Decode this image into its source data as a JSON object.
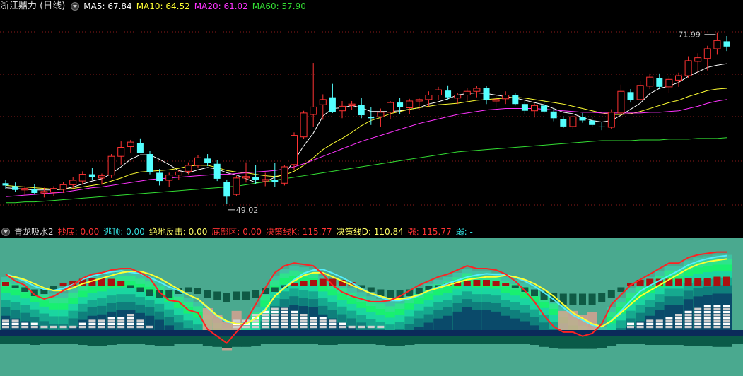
{
  "main_header": {
    "title": "浙江鼎力 (日线)",
    "ma": [
      {
        "label": "MA5: 67.84",
        "color": "#ffffff"
      },
      {
        "label": "MA10: 64.52",
        "color": "#ffff33"
      },
      {
        "label": "MA20: 61.02",
        "color": "#ff33ff"
      },
      {
        "label": "MA60: 57.90",
        "color": "#33dd33"
      }
    ]
  },
  "price_annotations": {
    "high": "71.99",
    "low": "49.02"
  },
  "indicator_header": {
    "title": "青龙吸水2",
    "items": [
      {
        "label": "抄底: 0.00",
        "color": "#ff3333"
      },
      {
        "label": "逃顶: 0.00",
        "color": "#33dddd"
      },
      {
        "label": "绝地反击: 0.00",
        "color": "#ffff66"
      },
      {
        "label": "底部区: 0.00",
        "color": "#ff3333"
      },
      {
        "label": "决策线K: 115.77",
        "color": "#ff3333"
      },
      {
        "label": "决策线D: 110.84",
        "color": "#ffff66"
      },
      {
        "label": "强: 115.77",
        "color": "#ff3333"
      },
      {
        "label": "弱: -",
        "color": "#33dddd"
      }
    ]
  },
  "colors": {
    "up": "#ff3333",
    "down": "#54ffff",
    "grid": "#8b1a1a"
  },
  "chart_data": {
    "type": "candlestick",
    "ohlc": [
      [
        51.8,
        52.3,
        51.0,
        51.5
      ],
      [
        51.4,
        51.9,
        50.6,
        50.9
      ],
      [
        50.9,
        51.4,
        50.2,
        51.1
      ],
      [
        51.0,
        51.7,
        50.3,
        50.5
      ],
      [
        50.5,
        51.2,
        49.9,
        50.7
      ],
      [
        50.6,
        51.4,
        50.1,
        51.1
      ],
      [
        51.0,
        52.0,
        50.5,
        51.6
      ],
      [
        51.6,
        52.6,
        51.1,
        52.2
      ],
      [
        52.1,
        53.4,
        51.6,
        53.0
      ],
      [
        53.0,
        53.9,
        52.3,
        52.6
      ],
      [
        52.5,
        53.1,
        51.6,
        52.8
      ],
      [
        52.9,
        55.7,
        52.5,
        55.4
      ],
      [
        55.4,
        57.4,
        54.3,
        56.6
      ],
      [
        56.7,
        57.6,
        55.9,
        57.3
      ],
      [
        57.2,
        57.8,
        55.8,
        55.8
      ],
      [
        55.7,
        56.1,
        53.0,
        53.3
      ],
      [
        53.2,
        53.7,
        51.5,
        52.1
      ],
      [
        52.2,
        53.2,
        51.3,
        52.9
      ],
      [
        52.9,
        53.5,
        52.2,
        53.3
      ],
      [
        53.4,
        54.6,
        53.0,
        54.2
      ],
      [
        54.2,
        55.6,
        53.8,
        55.2
      ],
      [
        55.1,
        55.7,
        54.1,
        54.5
      ],
      [
        54.4,
        54.9,
        52.1,
        52.4
      ],
      [
        52.0,
        52.3,
        49.0,
        50.0
      ],
      [
        50.3,
        52.8,
        50.1,
        52.5
      ],
      [
        52.5,
        54.6,
        51.9,
        52.7
      ],
      [
        52.6,
        54.2,
        51.7,
        52.2
      ],
      [
        52.1,
        53.2,
        51.4,
        52.3
      ],
      [
        52.2,
        54.5,
        51.3,
        52.0
      ],
      [
        51.8,
        54.2,
        51.5,
        54.0
      ],
      [
        54.3,
        58.6,
        53.6,
        58.2
      ],
      [
        58.0,
        61.5,
        57.7,
        61.2
      ],
      [
        61.0,
        67.9,
        59.3,
        62.0
      ],
      [
        62.3,
        63.7,
        60.3,
        63.0
      ],
      [
        63.3,
        65.1,
        61.2,
        61.3
      ],
      [
        61.5,
        62.8,
        60.5,
        62.1
      ],
      [
        62.2,
        62.8,
        61.6,
        62.4
      ],
      [
        62.3,
        63.2,
        60.5,
        60.9
      ],
      [
        60.7,
        62.0,
        59.6,
        60.5
      ],
      [
        60.7,
        61.8,
        59.3,
        61.3
      ],
      [
        61.3,
        62.8,
        60.4,
        62.6
      ],
      [
        62.6,
        63.2,
        61.0,
        62.0
      ],
      [
        61.9,
        63.1,
        61.0,
        62.8
      ],
      [
        62.8,
        63.2,
        61.6,
        63.0
      ],
      [
        63.0,
        64.1,
        62.1,
        63.6
      ],
      [
        63.6,
        64.7,
        62.9,
        64.3
      ],
      [
        64.2,
        64.9,
        63.0,
        63.3
      ],
      [
        63.2,
        63.9,
        62.4,
        63.6
      ],
      [
        63.6,
        64.5,
        62.8,
        64.1
      ],
      [
        64.1,
        64.8,
        63.3,
        64.5
      ],
      [
        64.5,
        64.8,
        62.4,
        62.9
      ],
      [
        62.8,
        63.6,
        61.9,
        63.0
      ],
      [
        63.1,
        64.1,
        62.4,
        63.6
      ],
      [
        63.6,
        63.9,
        62.2,
        62.4
      ],
      [
        62.4,
        62.8,
        61.1,
        61.5
      ],
      [
        61.5,
        62.5,
        60.6,
        62.2
      ],
      [
        62.2,
        62.9,
        61.2,
        61.4
      ],
      [
        61.4,
        61.8,
        60.1,
        60.5
      ],
      [
        60.4,
        60.8,
        59.2,
        59.4
      ],
      [
        59.4,
        60.9,
        59.0,
        60.7
      ],
      [
        60.7,
        61.2,
        59.9,
        60.2
      ],
      [
        60.2,
        60.7,
        59.3,
        59.6
      ],
      [
        59.4,
        60.0,
        58.9,
        59.3
      ],
      [
        59.3,
        61.7,
        59.1,
        61.3
      ],
      [
        61.2,
        65.0,
        60.6,
        64.1
      ],
      [
        64.0,
        64.4,
        62.6,
        62.9
      ],
      [
        63.0,
        65.5,
        62.6,
        64.9
      ],
      [
        64.8,
        66.5,
        64.4,
        66.0
      ],
      [
        65.9,
        66.5,
        64.4,
        64.7
      ],
      [
        64.7,
        66.2,
        63.9,
        65.7
      ],
      [
        65.6,
        66.6,
        64.7,
        66.2
      ],
      [
        66.2,
        68.8,
        65.9,
        68.2
      ],
      [
        68.1,
        69.2,
        66.6,
        68.6
      ],
      [
        68.5,
        70.2,
        66.9,
        69.8
      ],
      [
        69.8,
        72.0,
        69.0,
        70.9
      ],
      [
        70.8,
        71.5,
        69.5,
        70.1
      ]
    ],
    "ma": {
      "MA5": [
        51.2,
        51.1,
        51.0,
        50.9,
        50.9,
        50.9,
        51.0,
        51.3,
        51.7,
        52.1,
        52.4,
        53.1,
        54.0,
        55.0,
        55.6,
        55.6,
        55.0,
        54.3,
        53.5,
        53.2,
        53.6,
        53.9,
        53.7,
        53.2,
        52.9,
        52.4,
        51.9,
        52.0,
        52.6,
        53.0,
        54.8,
        56.8,
        58.5,
        60.8,
        61.8,
        61.9,
        62.2,
        61.9,
        61.4,
        61.4,
        61.4,
        61.5,
        61.7,
        61.9,
        62.4,
        62.7,
        63.1,
        63.6,
        63.8,
        63.9,
        63.8,
        63.6,
        63.4,
        63.2,
        62.9,
        62.6,
        62.3,
        61.8,
        61.3,
        61.1,
        60.6,
        60.2,
        60.0,
        60.2,
        60.9,
        61.7,
        62.5,
        63.8,
        64.5,
        64.8,
        65.3,
        66.1,
        66.7,
        67.3,
        67.6,
        67.8
      ],
      "MA10": [
        51.5,
        51.4,
        51.3,
        51.2,
        51.1,
        51.0,
        51.0,
        51.1,
        51.3,
        51.5,
        51.7,
        52.1,
        52.5,
        53.0,
        53.3,
        53.4,
        53.5,
        53.6,
        53.8,
        54.1,
        54.2,
        54.2,
        53.9,
        53.5,
        53.3,
        53.2,
        53.0,
        52.8,
        52.7,
        52.9,
        53.4,
        54.2,
        55.2,
        56.3,
        57.1,
        57.8,
        58.6,
        59.5,
        60.2,
        60.6,
        61.1,
        61.4,
        61.7,
        61.9,
        62.1,
        62.3,
        62.4,
        62.5,
        62.7,
        62.9,
        63.0,
        63.1,
        63.2,
        63.3,
        63.2,
        63.0,
        62.8,
        62.6,
        62.4,
        62.1,
        61.8,
        61.5,
        61.2,
        61.0,
        61.0,
        61.1,
        61.4,
        61.8,
        62.2,
        62.6,
        62.9,
        63.4,
        63.8,
        64.2,
        64.4,
        64.5
      ],
      "MA20": [
        50.0,
        50.1,
        50.2,
        50.3,
        50.4,
        50.5,
        50.6,
        50.8,
        51.0,
        51.2,
        51.3,
        51.5,
        51.7,
        51.9,
        52.1,
        52.3,
        52.4,
        52.5,
        52.6,
        52.7,
        52.8,
        52.9,
        53.0,
        53.0,
        53.1,
        53.2,
        53.3,
        53.4,
        53.5,
        53.7,
        54.0,
        54.4,
        54.9,
        55.4,
        55.9,
        56.4,
        56.9,
        57.4,
        57.8,
        58.2,
        58.6,
        59.0,
        59.4,
        59.8,
        60.1,
        60.4,
        60.7,
        61.0,
        61.2,
        61.4,
        61.6,
        61.7,
        61.8,
        61.8,
        61.8,
        61.8,
        61.7,
        61.6,
        61.5,
        61.4,
        61.3,
        61.3,
        61.2,
        61.2,
        61.2,
        61.2,
        61.2,
        61.3,
        61.3,
        61.4,
        61.5,
        61.8,
        62.1,
        62.5,
        62.8,
        63.0
      ],
      "MA60": [
        49.2,
        49.2,
        49.3,
        49.3,
        49.4,
        49.5,
        49.6,
        49.7,
        49.8,
        49.9,
        50.0,
        50.1,
        50.2,
        50.3,
        50.4,
        50.5,
        50.6,
        50.7,
        50.8,
        50.9,
        51.0,
        51.1,
        51.2,
        51.3,
        51.4,
        51.6,
        51.8,
        52.0,
        52.2,
        52.4,
        52.6,
        52.8,
        53.0,
        53.2,
        53.4,
        53.6,
        53.8,
        54.0,
        54.2,
        54.4,
        54.6,
        54.8,
        55.0,
        55.2,
        55.4,
        55.6,
        55.8,
        56.0,
        56.1,
        56.2,
        56.3,
        56.4,
        56.5,
        56.6,
        56.7,
        56.8,
        56.9,
        57.0,
        57.1,
        57.2,
        57.3,
        57.4,
        57.5,
        57.5,
        57.5,
        57.5,
        57.6,
        57.6,
        57.6,
        57.7,
        57.7,
        57.7,
        57.8,
        57.8,
        57.8,
        57.9
      ]
    },
    "indicator": {
      "K": [
        100,
        95,
        92,
        85,
        82,
        84,
        88,
        92,
        97,
        100,
        101,
        103,
        104,
        104,
        101,
        97,
        87,
        81,
        80,
        74,
        72,
        60,
        55,
        50,
        58,
        66,
        78,
        90,
        101,
        106,
        108,
        107,
        106,
        100,
        92,
        87,
        84,
        82,
        80,
        80,
        81,
        84,
        88,
        92,
        95,
        98,
        100,
        103,
        106,
        104,
        104,
        103,
        100,
        95,
        88,
        80,
        70,
        62,
        58,
        58,
        55,
        57,
        64,
        78,
        85,
        92,
        96,
        100,
        104,
        108,
        108,
        112,
        114,
        115,
        116,
        116
      ],
      "D": [
        99,
        98,
        96,
        93,
        90,
        88,
        88,
        90,
        93,
        95,
        97,
        99,
        101,
        102,
        102,
        100,
        97,
        93,
        89,
        85,
        82,
        76,
        70,
        66,
        64,
        64,
        68,
        74,
        84,
        90,
        95,
        99,
        101,
        101,
        98,
        95,
        92,
        89,
        86,
        84,
        82,
        82,
        83,
        85,
        88,
        90,
        92,
        94,
        96,
        97,
        98,
        98,
        99,
        98,
        96,
        93,
        89,
        84,
        78,
        72,
        68,
        64,
        62,
        66,
        72,
        78,
        84,
        88,
        92,
        96,
        100,
        104,
        107,
        109,
        110,
        111
      ],
      "decision": [
        2,
        -1,
        -3,
        -5,
        -4,
        -2,
        1,
        3,
        5,
        6,
        6,
        5,
        3,
        -1,
        -3,
        -5,
        -6,
        -6,
        -4,
        -3,
        -4,
        -6,
        -7,
        -8,
        -7,
        -7,
        -6,
        -4,
        -3,
        -1,
        1,
        3,
        4,
        5,
        5,
        4,
        2,
        -1,
        -3,
        -5,
        -6,
        -6,
        -5,
        -4,
        -2,
        -1,
        1,
        2,
        3,
        4,
        4,
        3,
        1,
        -1,
        -3,
        -5,
        -7,
        -8,
        -9,
        -9,
        -9,
        -9,
        -8,
        -6,
        -3,
        1,
        4,
        5,
        5,
        5,
        5,
        6,
        6,
        6,
        7,
        7
      ],
      "bars": [
        3,
        3,
        2,
        2,
        1,
        1,
        1,
        1,
        2,
        3,
        3,
        4,
        4,
        5,
        3,
        1,
        0,
        0,
        0,
        0,
        0,
        0,
        0,
        0,
        3,
        3,
        5,
        6,
        7,
        7,
        6,
        5,
        4,
        4,
        3,
        2,
        1,
        1,
        1,
        1,
        0,
        0,
        0,
        0,
        0,
        0,
        0,
        0,
        0,
        0,
        0,
        0,
        0,
        0,
        0,
        0,
        0,
        0,
        0,
        0,
        0,
        0,
        0,
        0,
        0,
        2,
        2,
        3,
        3,
        4,
        5,
        6,
        7,
        8,
        8,
        8
      ]
    }
  }
}
